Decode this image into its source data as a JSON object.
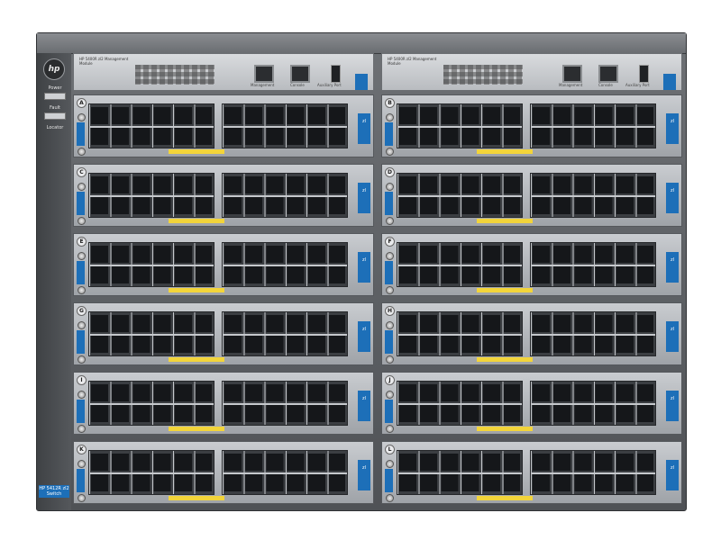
{
  "device": {
    "logo_text": "hp",
    "rail": {
      "power_label": "Power",
      "fault_label": "Fault",
      "locator_label": "Locator",
      "badge_text": "",
      "model_text": "HP 5412R zl2 Switch"
    },
    "management_modules": [
      {
        "title": "HP 5400R zl2 Management Module",
        "port_management": "Management",
        "port_console": "Console",
        "port_aux": "Auxiliary Port"
      },
      {
        "title": "HP 5400R zl2 Management Module",
        "port_management": "Management",
        "port_console": "Console",
        "port_aux": "Auxiliary Port"
      }
    ],
    "modules": [
      {
        "slot": "A",
        "tag": "zl"
      },
      {
        "slot": "B",
        "tag": "zl"
      },
      {
        "slot": "C",
        "tag": "zl"
      },
      {
        "slot": "D",
        "tag": "zl"
      },
      {
        "slot": "E",
        "tag": "zl"
      },
      {
        "slot": "F",
        "tag": "zl"
      },
      {
        "slot": "G",
        "tag": "zl"
      },
      {
        "slot": "H",
        "tag": "zl"
      },
      {
        "slot": "I",
        "tag": "zl"
      },
      {
        "slot": "J",
        "tag": "zl"
      },
      {
        "slot": "K",
        "tag": "zl"
      },
      {
        "slot": "L",
        "tag": "zl"
      }
    ],
    "colors": {
      "accent": "#1d6fb8",
      "label_yellow": "#f2d43a",
      "chassis": "#5a5d61"
    }
  }
}
